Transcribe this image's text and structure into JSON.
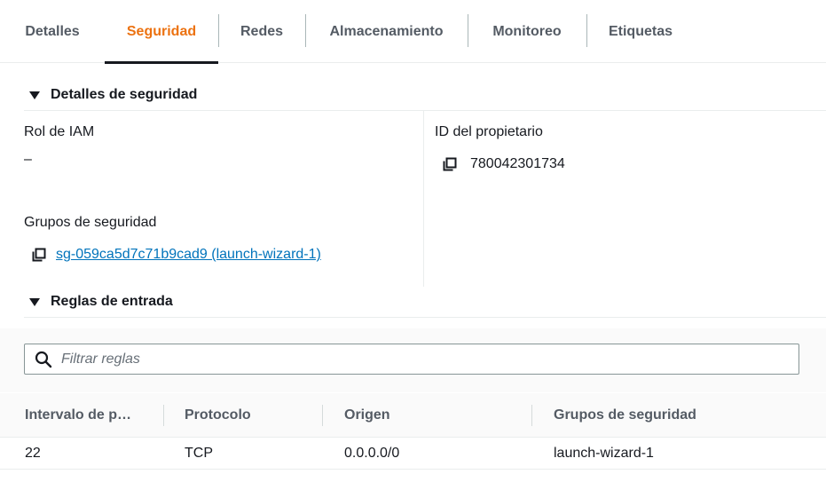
{
  "tabs": [
    {
      "label": "Detalles"
    },
    {
      "label": "Seguridad"
    },
    {
      "label": "Redes"
    },
    {
      "label": "Almacenamiento"
    },
    {
      "label": "Monitoreo"
    },
    {
      "label": "Etiquetas"
    }
  ],
  "active_tab": "Seguridad",
  "security_details": {
    "title": "Detalles de seguridad",
    "iam_role_label": "Rol de IAM",
    "iam_role_value": "–",
    "owner_id_label": "ID del propietario",
    "owner_id_value": "780042301734",
    "security_groups_label": "Grupos de seguridad",
    "security_group_link": "sg-059ca5d7c71b9cad9 (launch-wizard-1)"
  },
  "inbound_rules": {
    "title": "Reglas de entrada",
    "filter_placeholder": "Filtrar reglas",
    "columns": [
      "Intervalo de p…",
      "Protocolo",
      "Origen",
      "Grupos de seguridad"
    ],
    "rows": [
      {
        "port_range": "22",
        "protocol": "TCP",
        "source": "0.0.0.0/0",
        "security_groups": "launch-wizard-1"
      }
    ]
  },
  "colors": {
    "accent_orange": "#ec7211",
    "link_blue": "#0073bb",
    "text_dark": "#16191f",
    "text_gray": "#545b64"
  },
  "icons": [
    "caret-down-icon",
    "copy-icon",
    "search-icon"
  ]
}
